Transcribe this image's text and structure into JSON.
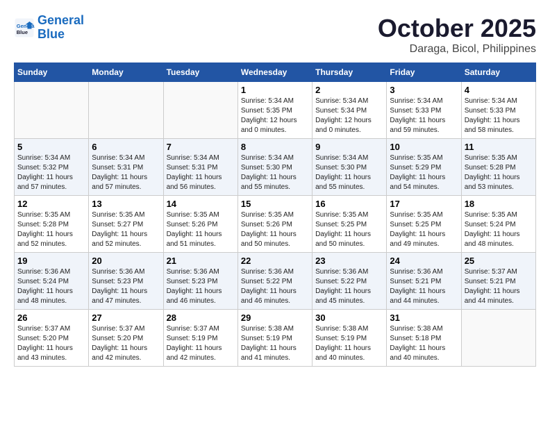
{
  "logo": {
    "line1": "General",
    "line2": "Blue"
  },
  "header": {
    "month": "October 2025",
    "location": "Daraga, Bicol, Philippines"
  },
  "weekdays": [
    "Sunday",
    "Monday",
    "Tuesday",
    "Wednesday",
    "Thursday",
    "Friday",
    "Saturday"
  ],
  "weeks": [
    [
      {
        "day": "",
        "info": ""
      },
      {
        "day": "",
        "info": ""
      },
      {
        "day": "",
        "info": ""
      },
      {
        "day": "1",
        "info": "Sunrise: 5:34 AM\nSunset: 5:35 PM\nDaylight: 12 hours\nand 0 minutes."
      },
      {
        "day": "2",
        "info": "Sunrise: 5:34 AM\nSunset: 5:34 PM\nDaylight: 12 hours\nand 0 minutes."
      },
      {
        "day": "3",
        "info": "Sunrise: 5:34 AM\nSunset: 5:33 PM\nDaylight: 11 hours\nand 59 minutes."
      },
      {
        "day": "4",
        "info": "Sunrise: 5:34 AM\nSunset: 5:33 PM\nDaylight: 11 hours\nand 58 minutes."
      }
    ],
    [
      {
        "day": "5",
        "info": "Sunrise: 5:34 AM\nSunset: 5:32 PM\nDaylight: 11 hours\nand 57 minutes."
      },
      {
        "day": "6",
        "info": "Sunrise: 5:34 AM\nSunset: 5:31 PM\nDaylight: 11 hours\nand 57 minutes."
      },
      {
        "day": "7",
        "info": "Sunrise: 5:34 AM\nSunset: 5:31 PM\nDaylight: 11 hours\nand 56 minutes."
      },
      {
        "day": "8",
        "info": "Sunrise: 5:34 AM\nSunset: 5:30 PM\nDaylight: 11 hours\nand 55 minutes."
      },
      {
        "day": "9",
        "info": "Sunrise: 5:34 AM\nSunset: 5:30 PM\nDaylight: 11 hours\nand 55 minutes."
      },
      {
        "day": "10",
        "info": "Sunrise: 5:35 AM\nSunset: 5:29 PM\nDaylight: 11 hours\nand 54 minutes."
      },
      {
        "day": "11",
        "info": "Sunrise: 5:35 AM\nSunset: 5:28 PM\nDaylight: 11 hours\nand 53 minutes."
      }
    ],
    [
      {
        "day": "12",
        "info": "Sunrise: 5:35 AM\nSunset: 5:28 PM\nDaylight: 11 hours\nand 52 minutes."
      },
      {
        "day": "13",
        "info": "Sunrise: 5:35 AM\nSunset: 5:27 PM\nDaylight: 11 hours\nand 52 minutes."
      },
      {
        "day": "14",
        "info": "Sunrise: 5:35 AM\nSunset: 5:26 PM\nDaylight: 11 hours\nand 51 minutes."
      },
      {
        "day": "15",
        "info": "Sunrise: 5:35 AM\nSunset: 5:26 PM\nDaylight: 11 hours\nand 50 minutes."
      },
      {
        "day": "16",
        "info": "Sunrise: 5:35 AM\nSunset: 5:25 PM\nDaylight: 11 hours\nand 50 minutes."
      },
      {
        "day": "17",
        "info": "Sunrise: 5:35 AM\nSunset: 5:25 PM\nDaylight: 11 hours\nand 49 minutes."
      },
      {
        "day": "18",
        "info": "Sunrise: 5:35 AM\nSunset: 5:24 PM\nDaylight: 11 hours\nand 48 minutes."
      }
    ],
    [
      {
        "day": "19",
        "info": "Sunrise: 5:36 AM\nSunset: 5:24 PM\nDaylight: 11 hours\nand 48 minutes."
      },
      {
        "day": "20",
        "info": "Sunrise: 5:36 AM\nSunset: 5:23 PM\nDaylight: 11 hours\nand 47 minutes."
      },
      {
        "day": "21",
        "info": "Sunrise: 5:36 AM\nSunset: 5:23 PM\nDaylight: 11 hours\nand 46 minutes."
      },
      {
        "day": "22",
        "info": "Sunrise: 5:36 AM\nSunset: 5:22 PM\nDaylight: 11 hours\nand 46 minutes."
      },
      {
        "day": "23",
        "info": "Sunrise: 5:36 AM\nSunset: 5:22 PM\nDaylight: 11 hours\nand 45 minutes."
      },
      {
        "day": "24",
        "info": "Sunrise: 5:36 AM\nSunset: 5:21 PM\nDaylight: 11 hours\nand 44 minutes."
      },
      {
        "day": "25",
        "info": "Sunrise: 5:37 AM\nSunset: 5:21 PM\nDaylight: 11 hours\nand 44 minutes."
      }
    ],
    [
      {
        "day": "26",
        "info": "Sunrise: 5:37 AM\nSunset: 5:20 PM\nDaylight: 11 hours\nand 43 minutes."
      },
      {
        "day": "27",
        "info": "Sunrise: 5:37 AM\nSunset: 5:20 PM\nDaylight: 11 hours\nand 42 minutes."
      },
      {
        "day": "28",
        "info": "Sunrise: 5:37 AM\nSunset: 5:19 PM\nDaylight: 11 hours\nand 42 minutes."
      },
      {
        "day": "29",
        "info": "Sunrise: 5:38 AM\nSunset: 5:19 PM\nDaylight: 11 hours\nand 41 minutes."
      },
      {
        "day": "30",
        "info": "Sunrise: 5:38 AM\nSunset: 5:19 PM\nDaylight: 11 hours\nand 40 minutes."
      },
      {
        "day": "31",
        "info": "Sunrise: 5:38 AM\nSunset: 5:18 PM\nDaylight: 11 hours\nand 40 minutes."
      },
      {
        "day": "",
        "info": ""
      }
    ]
  ]
}
